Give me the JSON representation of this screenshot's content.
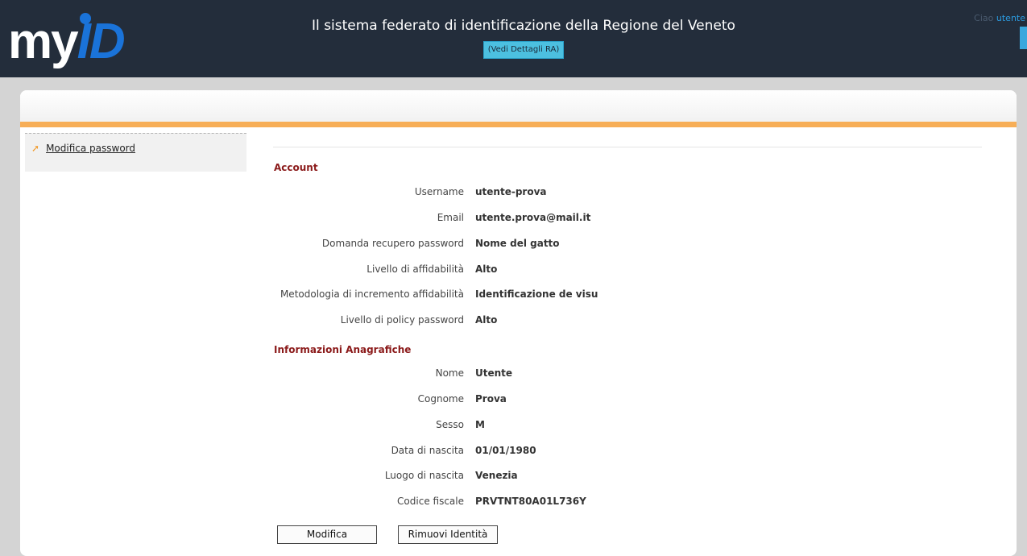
{
  "header": {
    "logo_my": "my",
    "logo_id": "ID",
    "title": "Il sistema federato di identificazione della Regione del Veneto",
    "ra_button": "(Vedi Dettagli RA)",
    "greeting": "Ciao",
    "username": "utente"
  },
  "sidebar": {
    "items": [
      {
        "label": "Modifica password",
        "icon": "arrow-icon"
      }
    ]
  },
  "account": {
    "title": "Account",
    "fields": [
      {
        "label": "Username",
        "value": "utente-prova"
      },
      {
        "label": "Email",
        "value": "utente.prova@mail.it"
      },
      {
        "label": "Domanda recupero password",
        "value": "Nome del gatto"
      },
      {
        "label": "Livello di affidabilità",
        "value": "Alto"
      },
      {
        "label": "Metodologia di incremento affidabilità",
        "value": "Identificazione de visu"
      },
      {
        "label": "Livello di policy password",
        "value": "Alto"
      }
    ]
  },
  "anagrafica": {
    "title": "Informazioni Anagrafiche",
    "fields": [
      {
        "label": "Nome",
        "value": "Utente"
      },
      {
        "label": "Cognome",
        "value": "Prova"
      },
      {
        "label": "Sesso",
        "value": "M"
      },
      {
        "label": "Data di nascita",
        "value": "01/01/1980"
      },
      {
        "label": "Luogo di nascita",
        "value": "Venezia"
      },
      {
        "label": "Codice fiscale",
        "value": "PRVTNT80A01L736Y"
      }
    ]
  },
  "actions": {
    "modifica": "Modifica",
    "rimuovi": "Rimuovi Identità"
  },
  "colors": {
    "header_bg": "#232d3b",
    "accent_orange": "#f7ae57",
    "section_title": "#8b1a1a",
    "ra_button": "#4cc0e0",
    "logo_blue": "#1a73d9"
  }
}
